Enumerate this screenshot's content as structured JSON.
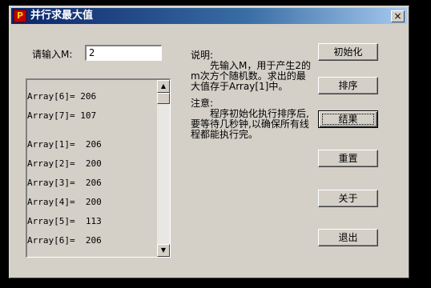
{
  "window": {
    "title": "并行求最大值",
    "close_glyph": "×",
    "app_icon_glyph": "P"
  },
  "input": {
    "label": "请输入M:",
    "value": "2"
  },
  "listbox": {
    "lines": [
      "Array[6]= 206",
      "Array[7]= 107",
      "",
      "Array[1]=  206",
      "Array[2]=  200",
      "Array[3]=  206",
      "Array[4]=  200",
      "Array[5]=  113",
      "Array[6]=  206"
    ],
    "scroll_up_glyph": "▲",
    "scroll_down_glyph": "▼"
  },
  "instructions": {
    "description_label": "说明:",
    "description_text": "先输入M，用于产生2的m次方个随机数。求出的最大值存于Array[1]中。",
    "note_label": "注意:",
    "note_text": "程序初始化执行排序后,要等待几秒钟,以确保所有线程都能执行完。"
  },
  "buttons": {
    "init": "初始化",
    "sort": "排序",
    "result": "结果",
    "reset": "重置",
    "about": "关于",
    "exit": "退出"
  }
}
